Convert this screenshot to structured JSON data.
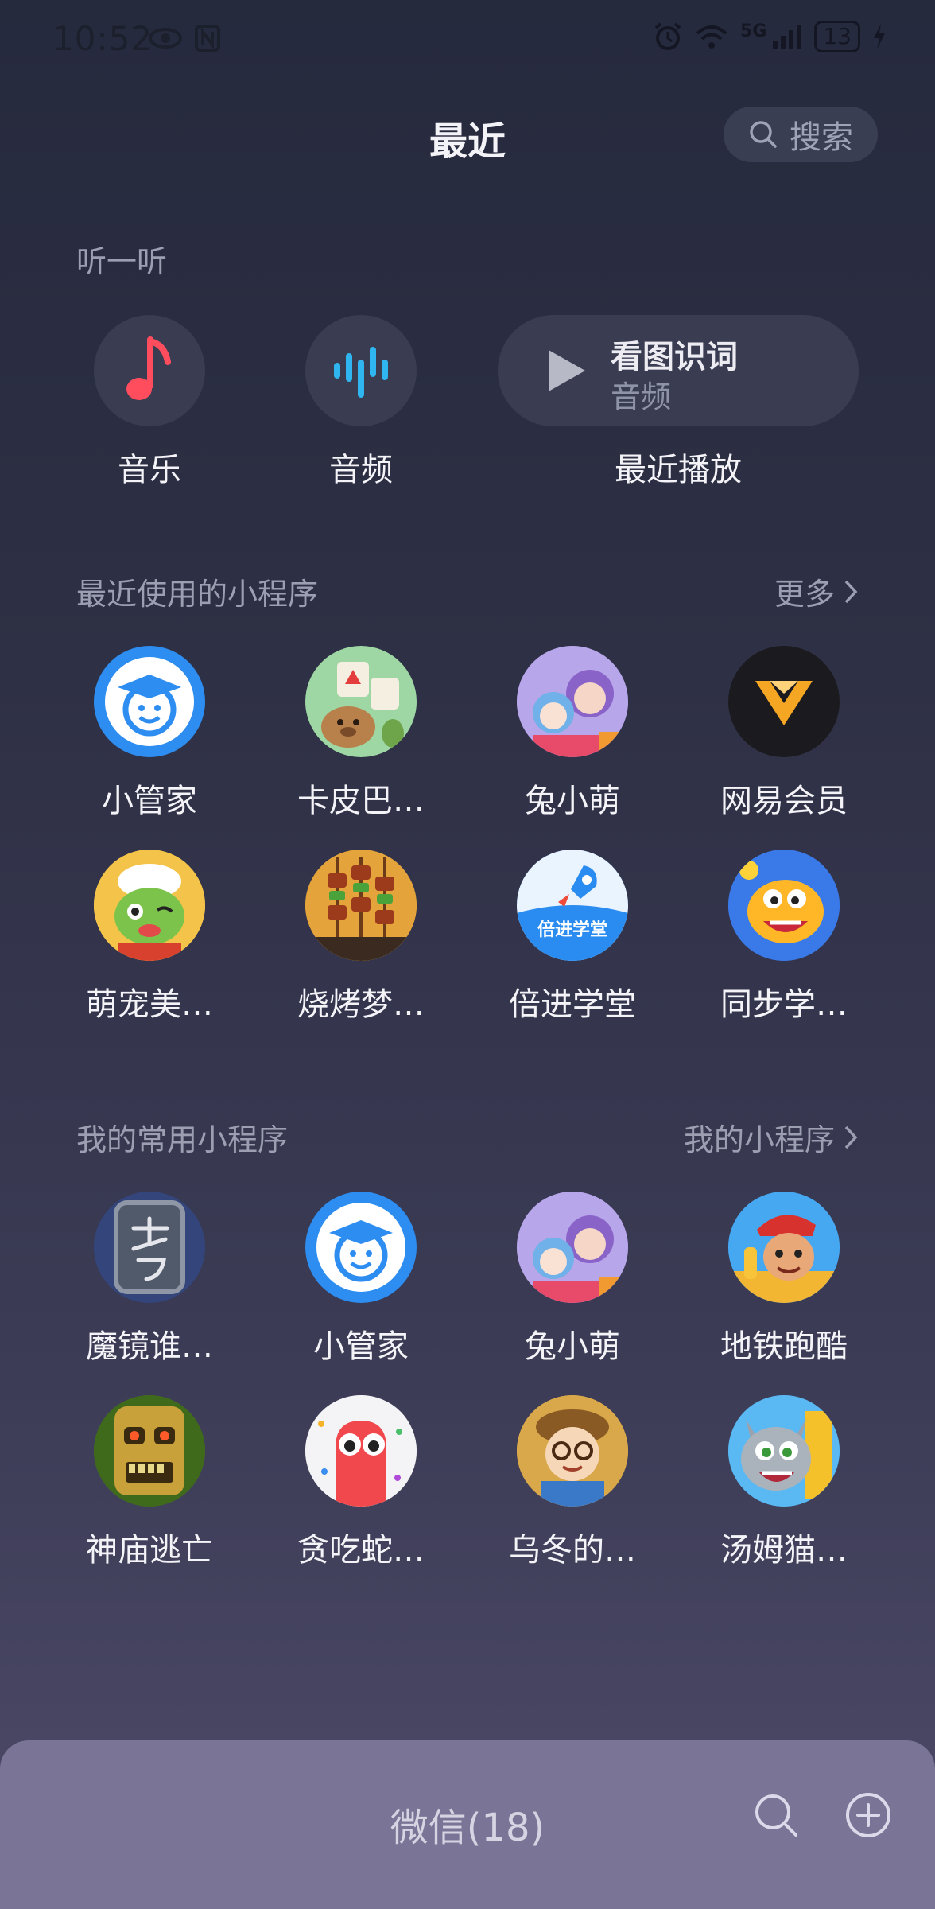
{
  "status_bar": {
    "time": "10:52",
    "network": "5G",
    "battery": "13"
  },
  "header": {
    "title": "最近",
    "search_label": "搜索"
  },
  "listen": {
    "section_title": "听一听",
    "items": [
      {
        "label": "音乐"
      },
      {
        "label": "音频"
      }
    ],
    "recent": {
      "title": "看图识词",
      "subtitle": "音频",
      "label": "最近播放"
    }
  },
  "recent_mini": {
    "section_title": "最近使用的小程序",
    "more": "更多",
    "apps": [
      {
        "label": "小管家"
      },
      {
        "label": "卡皮巴…"
      },
      {
        "label": "兔小萌"
      },
      {
        "label": "网易会员"
      },
      {
        "label": "萌宠美…"
      },
      {
        "label": "烧烤梦…"
      },
      {
        "label": "倍进学堂"
      },
      {
        "label": "同步学…"
      }
    ]
  },
  "favorite_mini": {
    "section_title": "我的常用小程序",
    "more": "我的小程序",
    "apps": [
      {
        "label": "魔镜谁…"
      },
      {
        "label": "小管家"
      },
      {
        "label": "兔小萌"
      },
      {
        "label": "地铁跑酷"
      },
      {
        "label": "神庙逃亡"
      },
      {
        "label": "贪吃蛇…"
      },
      {
        "label": "乌冬的…"
      },
      {
        "label": "汤姆猫…"
      }
    ]
  },
  "bottom_bar": {
    "title": "微信(18)"
  },
  "icons": {
    "music": "music-note-icon",
    "audio": "audio-wave-icon",
    "play": "play-icon",
    "search": "search-icon",
    "add": "add-circle-icon",
    "chevron": "chevron-right-icon"
  },
  "colors": {
    "music_accent": "#ff4d5e",
    "audio_accent": "#2fb6f0",
    "bottom_bar": "#7a7496"
  }
}
